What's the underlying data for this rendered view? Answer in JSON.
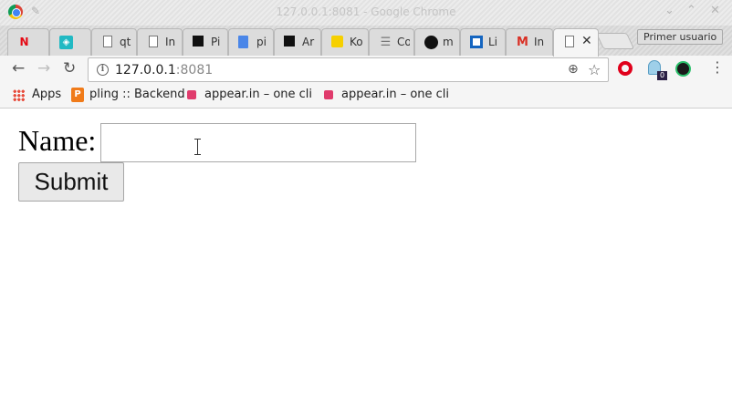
{
  "window": {
    "title": "127.0.0.1:8081 - Google Chrome",
    "controls": {
      "minimize": "⌄",
      "maximize": "⌃",
      "close": "✕"
    }
  },
  "tabs": [
    {
      "favicon": "netflix-icon",
      "glyph": "N",
      "title": ""
    },
    {
      "favicon": "shield-icon",
      "glyph": "◈",
      "title": ""
    },
    {
      "favicon": "document-icon",
      "glyph": "",
      "title": "qt"
    },
    {
      "favicon": "document-icon",
      "glyph": "",
      "title": "In"
    },
    {
      "favicon": "black-square-icon",
      "glyph": "",
      "title": "Pi"
    },
    {
      "favicon": "google-docs-icon",
      "glyph": "",
      "title": "pi"
    },
    {
      "favicon": "black-square-icon",
      "glyph": "",
      "title": "Ar"
    },
    {
      "favicon": "yellow-note-icon",
      "glyph": "",
      "title": "Ko"
    },
    {
      "favicon": "list-icon",
      "glyph": "☰",
      "title": "Co"
    },
    {
      "favicon": "github-icon",
      "glyph": "",
      "title": "m"
    },
    {
      "favicon": "trello-icon",
      "glyph": "",
      "title": "Li"
    },
    {
      "favicon": "gmail-icon",
      "glyph": "M",
      "title": "In"
    }
  ],
  "active_tab": {
    "favicon": "document-icon",
    "close": "✕"
  },
  "profile": {
    "label": "Primer usuario"
  },
  "toolbar": {
    "back": "←",
    "forward": "→",
    "reload": "↻",
    "url_host": "127.0.0.1",
    "url_port": ":8081",
    "zoom": "⊕",
    "star": "☆",
    "extension_badge": "0",
    "menu": "⋮"
  },
  "bookmarks": {
    "apps": "Apps",
    "pling_icon": "P",
    "pling": "pling :: Backend",
    "appear1": "appear.in – one click",
    "appear2": "appear.in – one click"
  },
  "form": {
    "name_label": "Name:",
    "name_value": "",
    "submit_label": "Submit"
  }
}
